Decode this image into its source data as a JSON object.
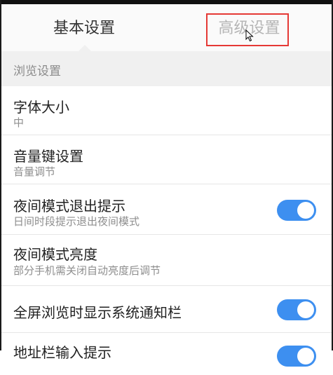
{
  "tabs": [
    {
      "label": "基本设置",
      "active": true
    },
    {
      "label": "高级设置",
      "active": false
    }
  ],
  "section": {
    "title": "浏览设置"
  },
  "settings": [
    {
      "title": "字体大小",
      "subtitle": "中"
    },
    {
      "title": "音量键设置",
      "subtitle": "音量调节"
    },
    {
      "title": "夜间模式退出提示",
      "subtitle": "日间时段提示退出夜间模式",
      "toggle": "on"
    },
    {
      "title": "夜间模式亮度",
      "subtitle": "部分手机需关闭自动亮度后调节"
    },
    {
      "title": "全屏浏览时显示系统通知栏",
      "toggle": "on"
    },
    {
      "title": "地址栏输入提示",
      "toggle": "on"
    }
  ],
  "colors": {
    "accent": "#3d8ff0",
    "highlight_box": "#e53935",
    "tab_active": "#333333",
    "tab_inactive": "#b5b5b5"
  },
  "icons": [
    "mouse-cursor-icon"
  ]
}
